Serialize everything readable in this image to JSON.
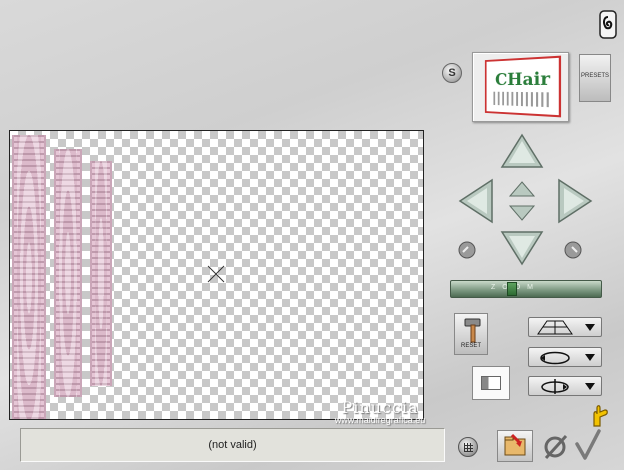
{
  "window": {
    "status_text": "(not valid)"
  },
  "top": {
    "s_label": "S",
    "presets_label": "PRESETS",
    "thumbnail_text": "CHair"
  },
  "zoom": {
    "label": "ZOOM"
  },
  "tools": {
    "reset_label": "RESET"
  },
  "watermark": {
    "line1": "Pinuccia",
    "line2": "www.maidiregrafica.eu"
  },
  "icons": {
    "help": "help-icon",
    "crosshair": "crosshair-icon",
    "hand": "hand-icon",
    "grid": "grid-icon",
    "save": "save-folder-icon",
    "cancel": "cancel-icon",
    "ok": "ok-checkmark-icon"
  },
  "colors": {
    "panel": "#d4d4d4",
    "strip_pink": "#e6c6d6",
    "arrow": "#b8c7bf",
    "zoom_green": "#6f8f74"
  }
}
